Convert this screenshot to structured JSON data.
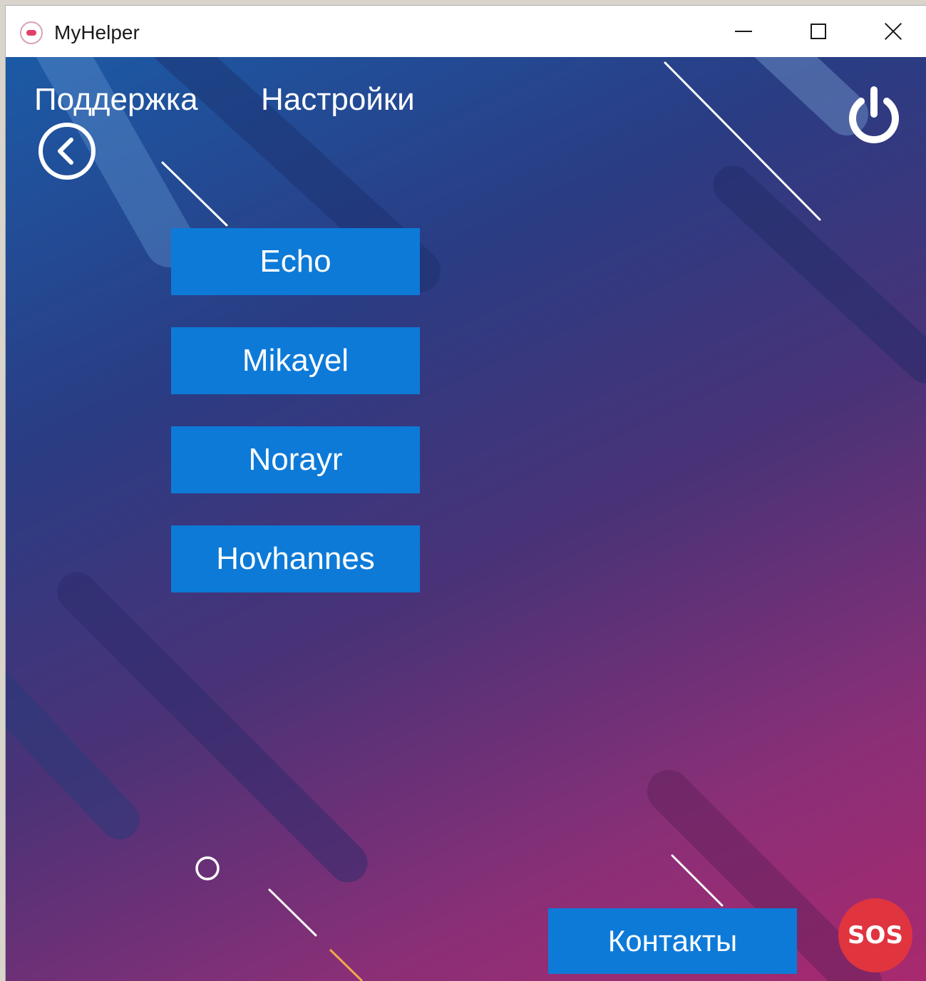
{
  "window": {
    "title": "MyHelper",
    "app_icon": "myhelper-app-icon",
    "controls": {
      "minimize_icon": "minimize-icon",
      "maximize_icon": "maximize-icon",
      "close_icon": "close-icon"
    }
  },
  "nav": {
    "support_label": "Поддержка",
    "settings_label": "Настройки"
  },
  "icons": {
    "back": "back-arrow-circle-icon",
    "power": "power-icon"
  },
  "contacts": [
    {
      "label": "Echo"
    },
    {
      "label": "Mikayel"
    },
    {
      "label": "Norayr"
    },
    {
      "label": "Hovhannes"
    }
  ],
  "footer": {
    "contacts_label": "Контакты",
    "sos_label": "SOS"
  },
  "colors": {
    "button_blue": "#0d7ad8",
    "sos_red": "#e0343f",
    "gradient_start": "#1c5aa6",
    "gradient_end": "#a8296f"
  }
}
